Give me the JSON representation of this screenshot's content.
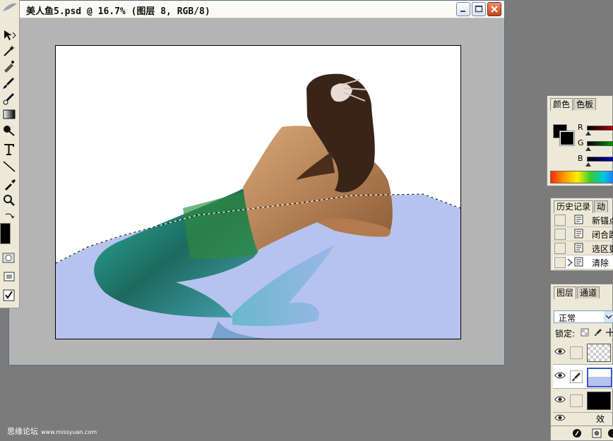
{
  "document": {
    "title": "美人鱼5.psd @ 16.7% (图层 8, RGB/8)"
  },
  "toolbox": {
    "foreground_color": "#000000",
    "background_color": "#ffffff"
  },
  "color_palette": {
    "tabs": [
      "颜色",
      "色板"
    ],
    "channels": [
      "R",
      "G",
      "B"
    ]
  },
  "history_palette": {
    "tabs": [
      "历史记录",
      "动"
    ],
    "items": [
      {
        "label": "新锚点"
      },
      {
        "label": "闭合路"
      },
      {
        "label": "选区更"
      },
      {
        "label": "清除",
        "selected": true
      }
    ]
  },
  "layers_palette": {
    "tabs": [
      "图层",
      "通道"
    ],
    "blend_mode": "正常",
    "lock_label": "锁定:",
    "effect_label": "效果"
  },
  "watermark": {
    "site_name": "思缘论坛",
    "url": "www.missyuan.com"
  },
  "colors": {
    "window_border": "#5a6c8a",
    "canvas_bg": "#b4b4b4",
    "workspace_bg": "#7b7b7b",
    "water": "#b6c3ee"
  }
}
